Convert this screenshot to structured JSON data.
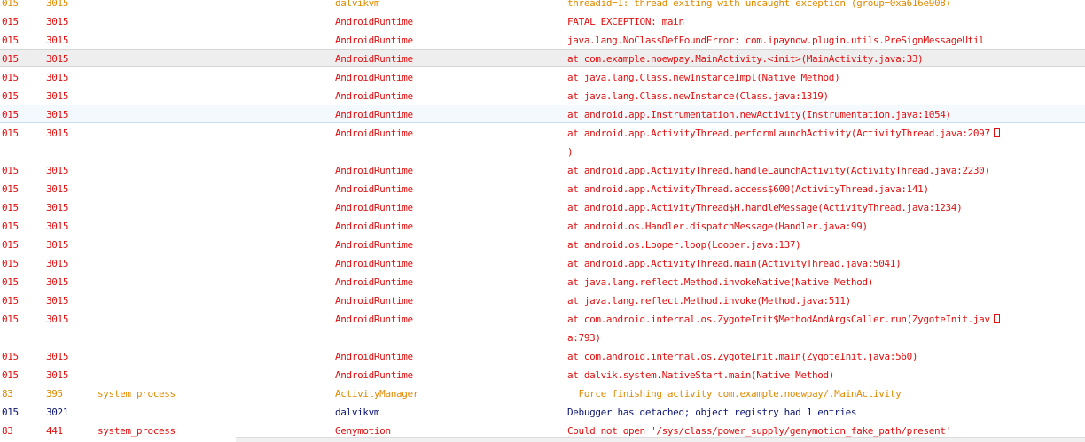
{
  "colors": {
    "error": "#e01010",
    "warn": "#e08a00",
    "debug": "#0d1670",
    "selected_row_bg": "#eeeeee",
    "hover_row_bg": "#f4f9fd"
  },
  "rows": [
    {
      "pid": "015",
      "tid": "3015",
      "app": "",
      "tag": "dalvikvm",
      "msg": "threadid=1: thread exiting with uncaught exception (group=0xa616e908)",
      "level": "W"
    },
    {
      "pid": "015",
      "tid": "3015",
      "app": "",
      "tag": "AndroidRuntime",
      "msg": "FATAL EXCEPTION: main",
      "level": "E"
    },
    {
      "pid": "015",
      "tid": "3015",
      "app": "",
      "tag": "AndroidRuntime",
      "msg": "java.lang.NoClassDefFoundError: com.ipaynow.plugin.utils.PreSignMessageUtil",
      "level": "E"
    },
    {
      "pid": "015",
      "tid": "3015",
      "app": "",
      "tag": "AndroidRuntime",
      "msg": "at com.example.noewpay.MainActivity.<init>(MainActivity.java:33)",
      "level": "E",
      "state": "selected"
    },
    {
      "pid": "015",
      "tid": "3015",
      "app": "",
      "tag": "AndroidRuntime",
      "msg": "at java.lang.Class.newInstanceImpl(Native Method)",
      "level": "E"
    },
    {
      "pid": "015",
      "tid": "3015",
      "app": "",
      "tag": "AndroidRuntime",
      "msg": "at java.lang.Class.newInstance(Class.java:1319)",
      "level": "E"
    },
    {
      "pid": "015",
      "tid": "3015",
      "app": "",
      "tag": "AndroidRuntime",
      "msg": "at android.app.Instrumentation.newActivity(Instrumentation.java:1054)",
      "level": "E",
      "state": "hover"
    },
    {
      "pid": "015",
      "tid": "3015",
      "app": "",
      "tag": "AndroidRuntime",
      "msg": "at android.app.ActivityThread.performLaunchActivity(ActivityThread.java:2097",
      "msg2": ")",
      "level": "E",
      "wrapped": true
    },
    {
      "pid": "015",
      "tid": "3015",
      "app": "",
      "tag": "AndroidRuntime",
      "msg": "at android.app.ActivityThread.handleLaunchActivity(ActivityThread.java:2230)",
      "level": "E"
    },
    {
      "pid": "015",
      "tid": "3015",
      "app": "",
      "tag": "AndroidRuntime",
      "msg": "at android.app.ActivityThread.access$600(ActivityThread.java:141)",
      "level": "E"
    },
    {
      "pid": "015",
      "tid": "3015",
      "app": "",
      "tag": "AndroidRuntime",
      "msg": "at android.app.ActivityThread$H.handleMessage(ActivityThread.java:1234)",
      "level": "E"
    },
    {
      "pid": "015",
      "tid": "3015",
      "app": "",
      "tag": "AndroidRuntime",
      "msg": "at android.os.Handler.dispatchMessage(Handler.java:99)",
      "level": "E"
    },
    {
      "pid": "015",
      "tid": "3015",
      "app": "",
      "tag": "AndroidRuntime",
      "msg": "at android.os.Looper.loop(Looper.java:137)",
      "level": "E"
    },
    {
      "pid": "015",
      "tid": "3015",
      "app": "",
      "tag": "AndroidRuntime",
      "msg": "at android.app.ActivityThread.main(ActivityThread.java:5041)",
      "level": "E"
    },
    {
      "pid": "015",
      "tid": "3015",
      "app": "",
      "tag": "AndroidRuntime",
      "msg": "at java.lang.reflect.Method.invokeNative(Native Method)",
      "level": "E"
    },
    {
      "pid": "015",
      "tid": "3015",
      "app": "",
      "tag": "AndroidRuntime",
      "msg": "at java.lang.reflect.Method.invoke(Method.java:511)",
      "level": "E"
    },
    {
      "pid": "015",
      "tid": "3015",
      "app": "",
      "tag": "AndroidRuntime",
      "msg": "at com.android.internal.os.ZygoteInit$MethodAndArgsCaller.run(ZygoteInit.jav",
      "msg2": "a:793)",
      "level": "E",
      "wrapped": true
    },
    {
      "pid": "015",
      "tid": "3015",
      "app": "",
      "tag": "AndroidRuntime",
      "msg": "at com.android.internal.os.ZygoteInit.main(ZygoteInit.java:560)",
      "level": "E"
    },
    {
      "pid": "015",
      "tid": "3015",
      "app": "",
      "tag": "AndroidRuntime",
      "msg": "at dalvik.system.NativeStart.main(Native Method)",
      "level": "E"
    },
    {
      "pid": "83",
      "tid": "395",
      "app": "system_process",
      "tag": "ActivityManager",
      "msg": "  Force finishing activity com.example.noewpay/.MainActivity",
      "level": "W"
    },
    {
      "pid": "015",
      "tid": "3021",
      "app": "",
      "tag": "dalvikvm",
      "msg": "Debugger has detached; object registry had 1 entries",
      "level": "D"
    },
    {
      "pid": "83",
      "tid": "441",
      "app": "system_process",
      "tag": "Genymotion",
      "msg": "Could not open '/sys/class/power_supply/genymotion_fake_path/present'",
      "level": "E"
    }
  ]
}
